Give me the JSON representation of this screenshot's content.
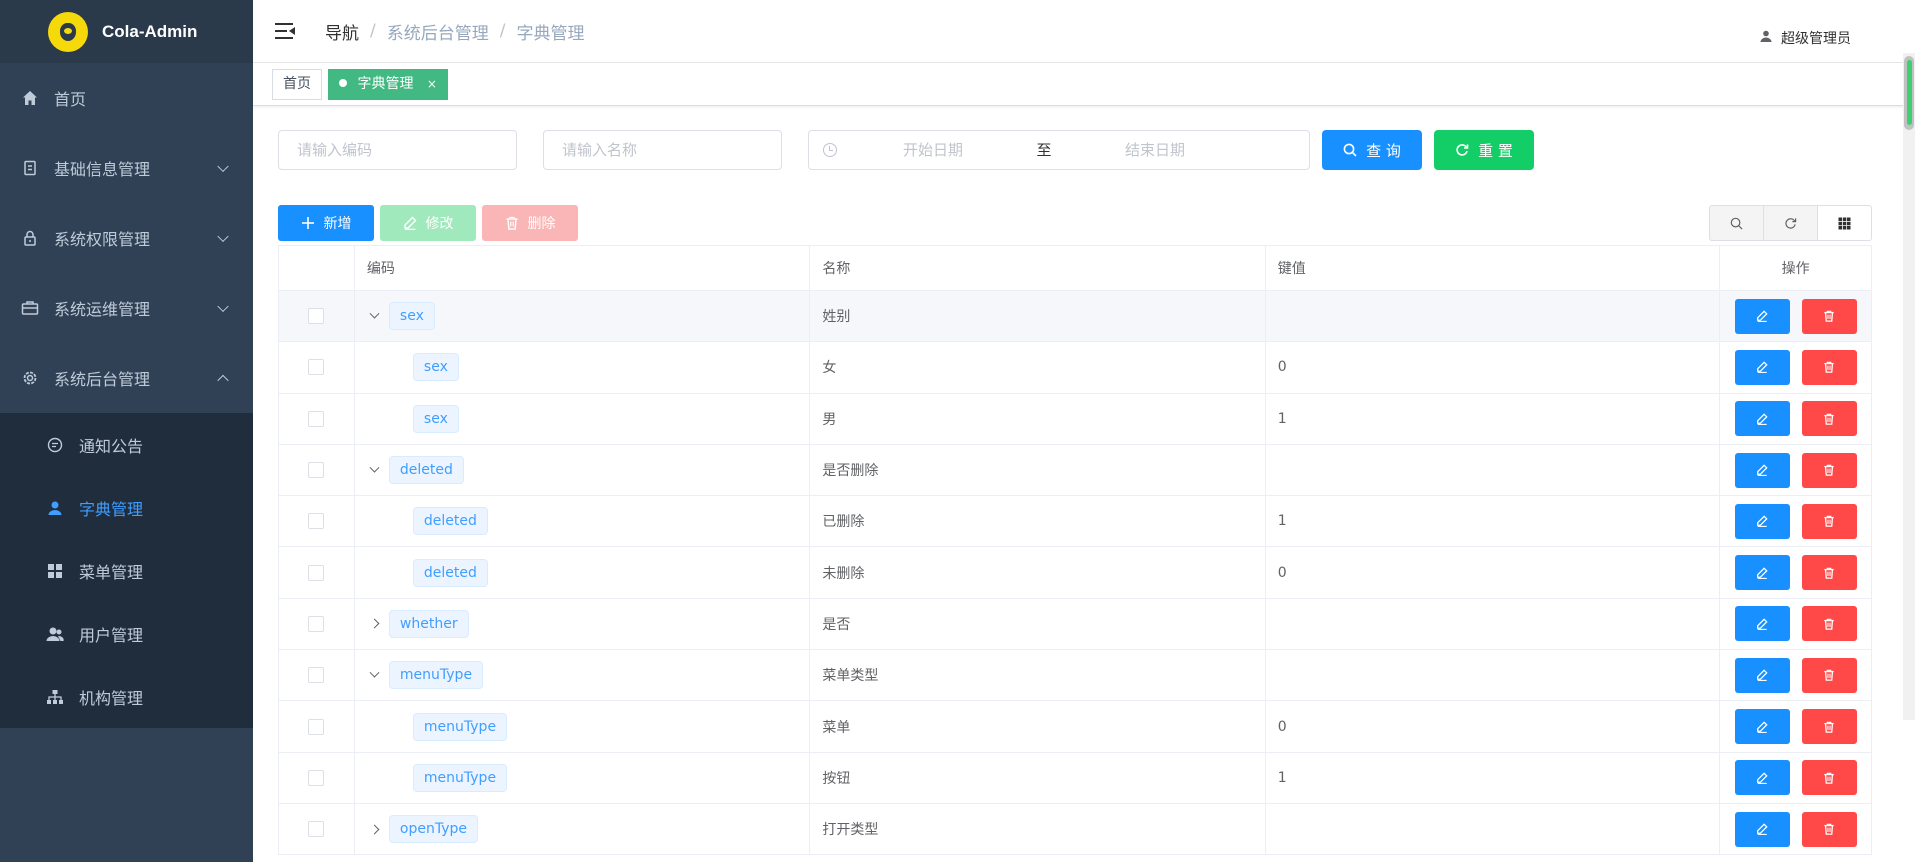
{
  "app": {
    "logo_text": "Cola-Admin"
  },
  "sidebar": {
    "items": [
      {
        "label": "首页",
        "icon": "home-icon"
      },
      {
        "label": "基础信息管理",
        "icon": "doc-icon"
      },
      {
        "label": "系统权限管理",
        "icon": "lock-icon"
      },
      {
        "label": "系统运维管理",
        "icon": "toolbox-icon"
      },
      {
        "label": "系统后台管理",
        "icon": "gear-icon"
      }
    ],
    "submenu": [
      {
        "label": "通知公告",
        "icon": "message-icon"
      },
      {
        "label": "字典管理",
        "icon": "user-icon"
      },
      {
        "label": "菜单管理",
        "icon": "grid-icon"
      },
      {
        "label": "用户管理",
        "icon": "users-icon"
      },
      {
        "label": "机构管理",
        "icon": "tree-icon"
      }
    ]
  },
  "header": {
    "breadcrumb": [
      "导航",
      "系统后台管理",
      "字典管理"
    ],
    "breadcrumb_sep": "/",
    "user": "超级管理员"
  },
  "tags": [
    {
      "label": "首页"
    },
    {
      "label": "字典管理",
      "close": "×"
    }
  ],
  "search": {
    "code_placeholder": "请输入编码",
    "name_placeholder": "请输入名称",
    "start_placeholder": "开始日期",
    "range_sep": "至",
    "end_placeholder": "结束日期",
    "query_label": "查 询",
    "reset_label": "重 置"
  },
  "toolbar": {
    "add_label": "新增",
    "edit_label": "修改",
    "delete_label": "删除"
  },
  "table": {
    "headers": [
      "编码",
      "名称",
      "键值",
      "操作"
    ],
    "rows": [
      {
        "code": "sex",
        "name": "姓别",
        "value": ""
      },
      {
        "code": "sex",
        "name": "女",
        "value": "0"
      },
      {
        "code": "sex",
        "name": "男",
        "value": "1"
      },
      {
        "code": "deleted",
        "name": "是否删除",
        "value": ""
      },
      {
        "code": "deleted",
        "name": "已删除",
        "value": "1"
      },
      {
        "code": "deleted",
        "name": "未删除",
        "value": "0"
      },
      {
        "code": "whether",
        "name": "是否",
        "value": ""
      },
      {
        "code": "menuType",
        "name": "菜单类型",
        "value": ""
      },
      {
        "code": "menuType",
        "name": "菜单",
        "value": "0"
      },
      {
        "code": "menuType",
        "name": "按钮",
        "value": "1"
      },
      {
        "code": "openType",
        "name": "打开类型",
        "value": ""
      }
    ]
  },
  "colors": {
    "sidebar_bg": "#304156",
    "primary": "#1890ff",
    "success": "#13ce66",
    "danger": "#ff4949",
    "active_tag": "#42b983"
  }
}
